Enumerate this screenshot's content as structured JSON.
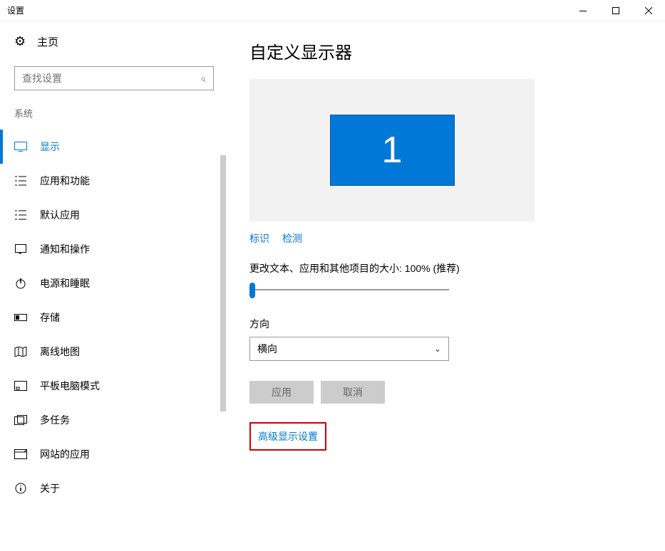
{
  "window": {
    "title": "设置"
  },
  "sidebar": {
    "home": "主页",
    "search_placeholder": "查找设置",
    "section": "系统",
    "items": [
      {
        "icon": "display",
        "label": "显示"
      },
      {
        "icon": "apps",
        "label": "应用和功能"
      },
      {
        "icon": "defaults",
        "label": "默认应用"
      },
      {
        "icon": "notif",
        "label": "通知和操作"
      },
      {
        "icon": "power",
        "label": "电源和睡眠"
      },
      {
        "icon": "storage",
        "label": "存储"
      },
      {
        "icon": "maps",
        "label": "离线地图"
      },
      {
        "icon": "tablet",
        "label": "平板电脑模式"
      },
      {
        "icon": "multi",
        "label": "多任务"
      },
      {
        "icon": "web",
        "label": "网站的应用"
      },
      {
        "icon": "about",
        "label": "关于"
      }
    ]
  },
  "main": {
    "title": "自定义显示器",
    "monitor_number": "1",
    "identify": "标识",
    "detect": "检测",
    "scale_label": "更改文本、应用和其他项目的大小: 100% (推荐)",
    "orientation_label": "方向",
    "orientation_value": "横向",
    "apply_btn": "应用",
    "cancel_btn": "取消",
    "advanced_link": "高级显示设置"
  }
}
